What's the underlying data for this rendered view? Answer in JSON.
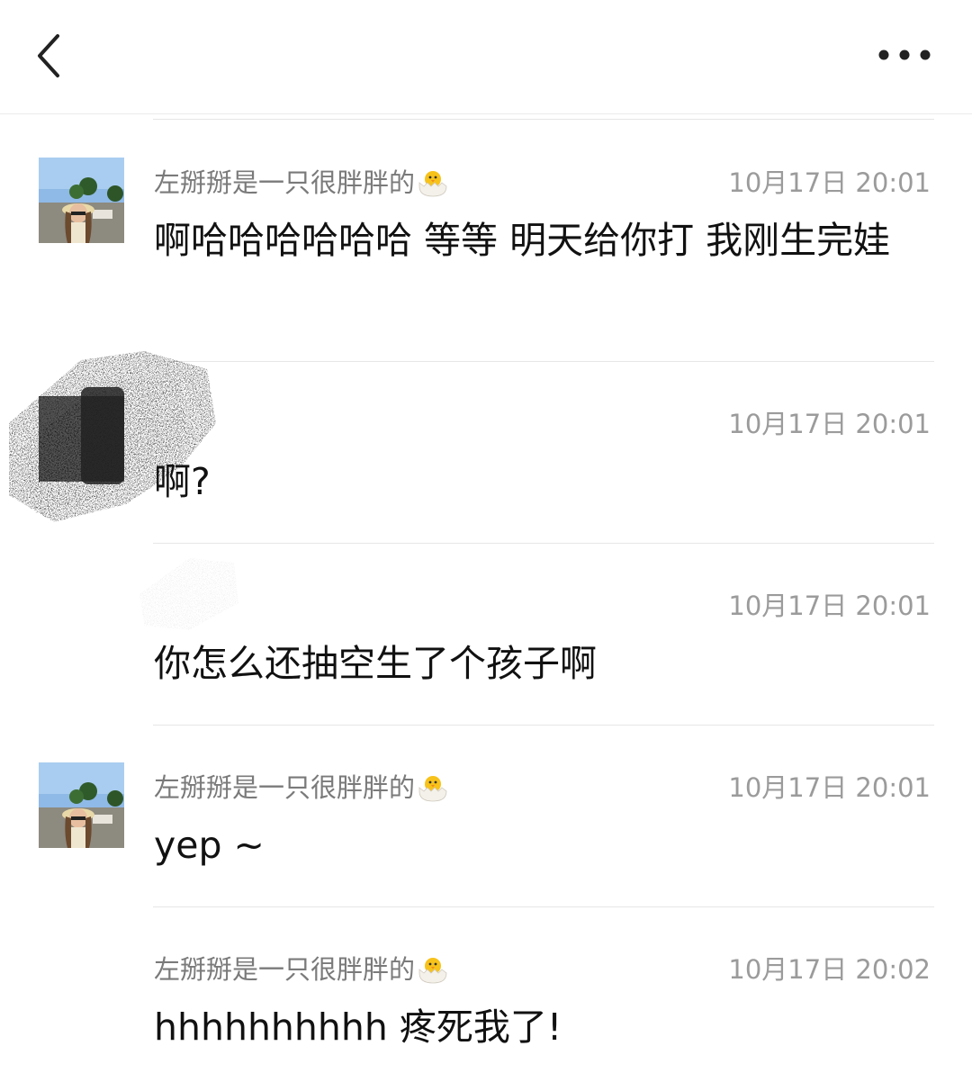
{
  "messages": [
    {
      "name": "左掰掰是一只很胖胖的",
      "time": "10月17日 20:01",
      "text": "啊哈哈哈哈哈哈 等等 明天给你打 我刚生完娃"
    },
    {
      "name": "",
      "time": "10月17日 20:01",
      "text": "啊?"
    },
    {
      "name": "",
      "time": "10月17日 20:01",
      "text": "你怎么还抽空生了个孩子啊"
    },
    {
      "name": "左掰掰是一只很胖胖的",
      "time": "10月17日 20:01",
      "text": "yep ~"
    },
    {
      "name": "左掰掰是一只很胖胖的",
      "time": "10月17日 20:02",
      "text": "hhhhhhhhhh 疼死我了!"
    }
  ]
}
